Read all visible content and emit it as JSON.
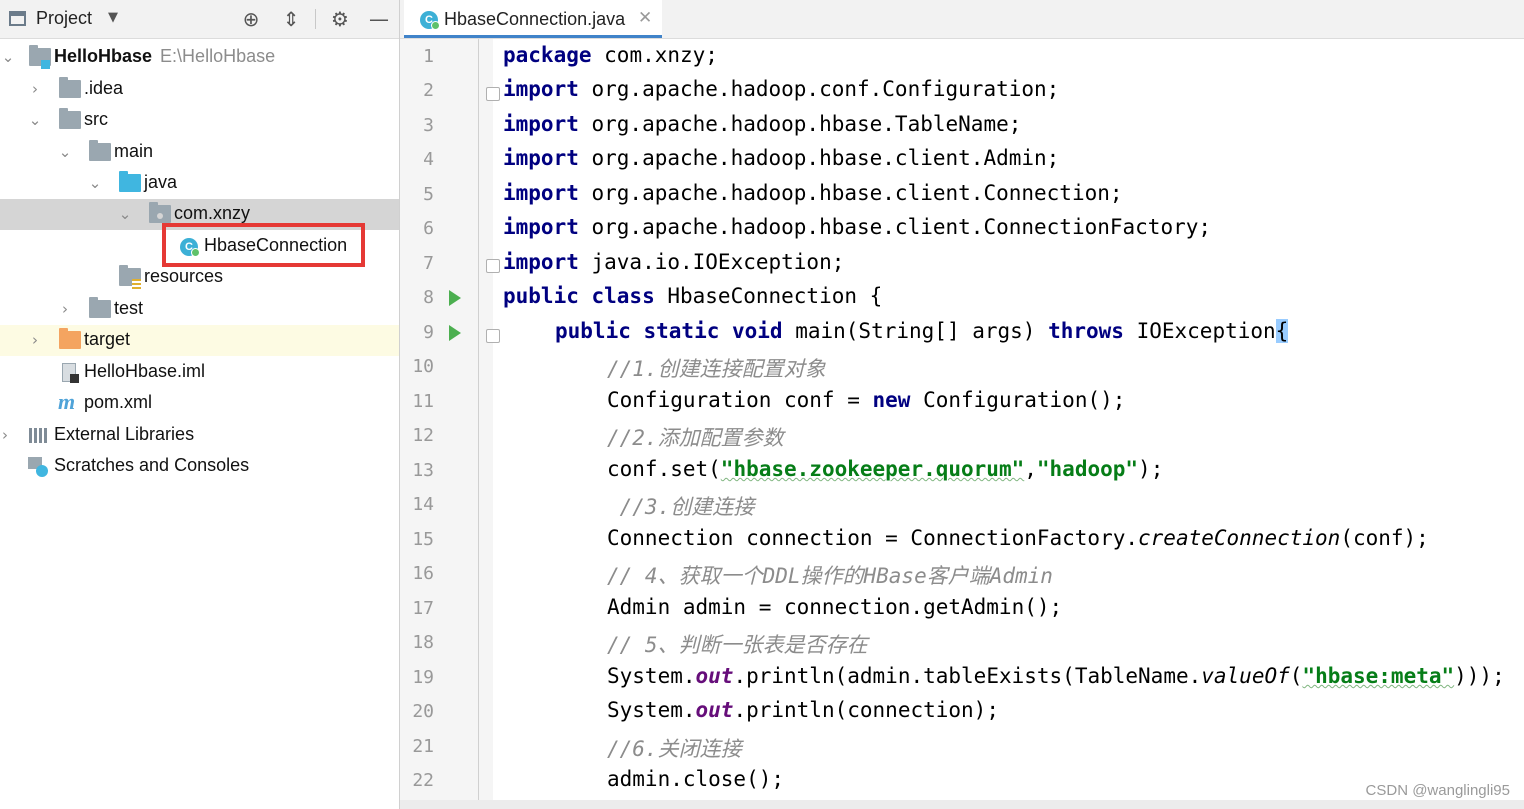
{
  "project_panel": {
    "title": "Project",
    "tree": [
      {
        "label": "HelloHbase",
        "path": "E:\\HelloHbase"
      },
      {
        "label": ".idea"
      },
      {
        "label": "src"
      },
      {
        "label": "main"
      },
      {
        "label": "java"
      },
      {
        "label": "com.xnzy"
      },
      {
        "label": "HbaseConnection"
      },
      {
        "label": "resources"
      },
      {
        "label": "test"
      },
      {
        "label": "target"
      },
      {
        "label": "HelloHbase.iml"
      },
      {
        "label": "pom.xml"
      },
      {
        "label": "External Libraries"
      },
      {
        "label": "Scratches and Consoles"
      }
    ]
  },
  "editor": {
    "tab_title": "HbaseConnection.java",
    "line_numbers": [
      "1",
      "2",
      "3",
      "4",
      "5",
      "6",
      "7",
      "8",
      "9",
      "10",
      "11",
      "12",
      "13",
      "14",
      "15",
      "16",
      "17",
      "18",
      "19",
      "20",
      "21",
      "22"
    ],
    "code": {
      "l1_kw": "package",
      "l1_rest": " com.xnzy;",
      "import_kw": "import",
      "l2_rest": " org.apache.hadoop.conf.Configuration;",
      "l3_rest": " org.apache.hadoop.hbase.TableName;",
      "l4_rest": " org.apache.hadoop.hbase.client.Admin;",
      "l5_rest": " org.apache.hadoop.hbase.client.Connection;",
      "l6_rest": " org.apache.hadoop.hbase.client.ConnectionFactory;",
      "l7_rest": " java.io.IOException;",
      "l8_kw": "public class",
      "l8_rest": " HbaseConnection {",
      "l9_kw1": "public static void",
      "l9_mid": " main(String[] args) ",
      "l9_kw2": "throws",
      "l9_rest": " IOException",
      "l9_brace": "{",
      "l10": "//1.创建连接配置对象",
      "l11_a": "Configuration conf = ",
      "l11_kw": "new",
      "l11_b": " Configuration();",
      "l12": "//2.添加配置参数",
      "l13_a": "conf.set(",
      "l13_s1": "\"hbase.zookeeper.quorum\"",
      "l13_b": ",",
      "l13_s2": "\"hadoop\"",
      "l13_c": ");",
      "l14": " //3.创建连接",
      "l15_a": "Connection connection = ConnectionFactory.",
      "l15_i": "createConnection",
      "l15_b": "(conf);",
      "l16": "// 4、获取一个DDL操作的HBase客户端Admin",
      "l17": "Admin admin = connection.getAdmin();",
      "l18": "// 5、判断一张表是否存在",
      "l19_a": "System.",
      "l19_f": "out",
      "l19_b": ".println(admin.tableExists(TableName.",
      "l19_i": "valueOf",
      "l19_c": "(",
      "l19_s": "\"hbase:meta\"",
      "l19_d": ")));",
      "l20_a": "System.",
      "l20_f": "out",
      "l20_b": ".println(connection);",
      "l21": "//6.关闭连接",
      "l22": "admin.close();"
    }
  },
  "watermark": "CSDN @wanglingli95"
}
